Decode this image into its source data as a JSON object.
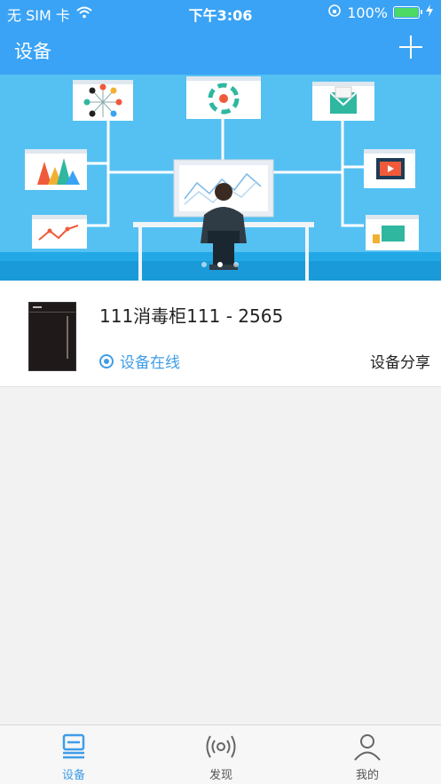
{
  "status_bar": {
    "carrier": "无 SIM 卡",
    "time": "下午3:06",
    "battery_percent": "100%"
  },
  "nav_bar": {
    "title": "设备"
  },
  "device": {
    "name": "111消毒柜111 - 2565",
    "status": "设备在线",
    "share_label": "设备分享"
  },
  "tabs": [
    {
      "label": "设备",
      "icon": "device-icon",
      "active": true
    },
    {
      "label": "发现",
      "icon": "signal-icon",
      "active": false
    },
    {
      "label": "我的",
      "icon": "user-icon",
      "active": false
    }
  ],
  "colors": {
    "brand_blue": "#3aa3f5",
    "banner_blue": "#54c1f2",
    "online_blue": "#3f9de8",
    "battery_green": "#4cd964"
  }
}
